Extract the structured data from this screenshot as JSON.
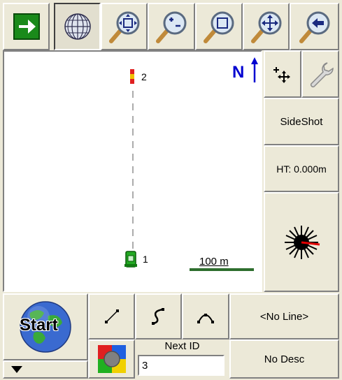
{
  "colors": {
    "panel": "#ece9d8",
    "map_bg": "#ffffff",
    "go_green": "#1a8a1a",
    "north_blue": "#0000d0",
    "scale_green": "#2e6e2e",
    "laser_red": "#e00000"
  },
  "toolbar": {
    "buttons": [
      {
        "icon": "go-arrow-icon"
      },
      {
        "icon": "globe-icon"
      },
      {
        "icon": "zoom-extents-icon"
      },
      {
        "icon": "zoom-in-out-icon"
      },
      {
        "icon": "zoom-window-icon"
      },
      {
        "icon": "pan-icon"
      },
      {
        "icon": "zoom-previous-icon"
      }
    ]
  },
  "map": {
    "north_label": "N",
    "point_top_label": "2",
    "point_bottom_label": "1",
    "scale_label": "100 m"
  },
  "side_panel": {
    "sideshot_label": "SideShot",
    "ht_label": "HT: 0.000m"
  },
  "bottom": {
    "start_label": "Start",
    "line_select_label": "<No Line>",
    "next_id_label": "Next ID",
    "next_id_value": "3",
    "desc_label": "No Desc"
  }
}
